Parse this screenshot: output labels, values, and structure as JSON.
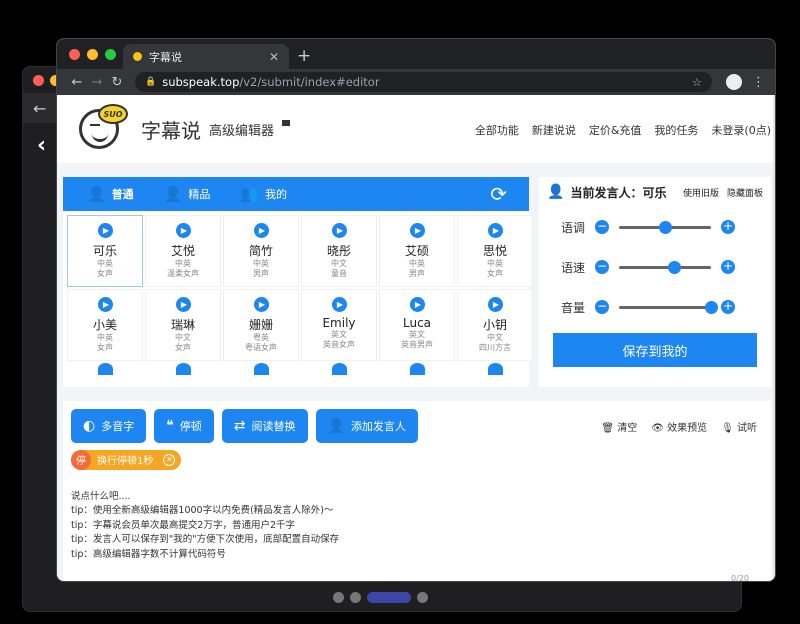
{
  "browser": {
    "tab_title": "字幕说",
    "new_tab": "+",
    "url_host": "subspeak.top",
    "url_path": "/v2/submit/index#editor"
  },
  "header": {
    "logo_text": "SUO",
    "brand": "字幕说",
    "subtitle": "高级编辑器",
    "menu": [
      "全部功能",
      "新建说说",
      "定价&充值",
      "我的任务",
      "未登录(0点)"
    ]
  },
  "voice_tabs": [
    "普通",
    "精品",
    "我的"
  ],
  "voices": [
    {
      "name": "可乐",
      "lang": "中英",
      "desc": "女声",
      "selected": true
    },
    {
      "name": "艾悦",
      "lang": "中英",
      "desc": "温柔女声"
    },
    {
      "name": "简竹",
      "lang": "中英",
      "desc": "男声"
    },
    {
      "name": "晓彤",
      "lang": "中文",
      "desc": "童音"
    },
    {
      "name": "艾硕",
      "lang": "中英",
      "desc": "男声"
    },
    {
      "name": "思悦",
      "lang": "中英",
      "desc": "女声"
    },
    {
      "name": "小美",
      "lang": "中英",
      "desc": "女声"
    },
    {
      "name": "瑞琳",
      "lang": "中文",
      "desc": "女声"
    },
    {
      "name": "姗姗",
      "lang": "粤英",
      "desc": "粤语女声"
    },
    {
      "name": "Emily",
      "lang": "英文",
      "desc": "英音女声"
    },
    {
      "name": "Luca",
      "lang": "英文",
      "desc": "英音男声"
    },
    {
      "name": "小钥",
      "lang": "中文",
      "desc": "四川方言"
    }
  ],
  "speaker_panel": {
    "title": "当前发言人：可乐",
    "old_version": "使用旧版",
    "hide_panel": "隐藏面板",
    "sliders": [
      {
        "label": "语调",
        "level": 0.5
      },
      {
        "label": "语速",
        "level": 0.6
      },
      {
        "label": "音量",
        "level": 1.0
      }
    ],
    "save_button": "保存到我的"
  },
  "editor": {
    "tools": [
      "多音字",
      "停顿",
      "阅读替换",
      "添加发言人"
    ],
    "right_actions": [
      "清空",
      "效果预览",
      "试听"
    ],
    "tag_badge": "停",
    "tag_label": "换行停顿1秒",
    "lines": [
      "说点什么吧....",
      "tip：使用全新高级编辑器1000字以内免费(精品发言人除外)〜",
      "tip：字幕说会员单次最高提交2万字，普通用户2千字",
      "tip：发言人可以保存到\"我的\"方便下次使用，底部配置自动保存",
      "tip：高级编辑器字数不计算代码符号"
    ],
    "count": "0/20"
  },
  "colors": {
    "accent": "#1e86f0",
    "tag": "#f5a623",
    "tag_badge": "#f26b3a"
  }
}
